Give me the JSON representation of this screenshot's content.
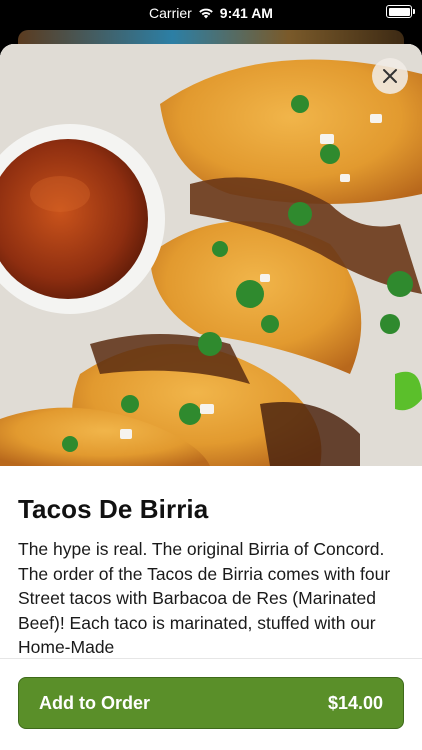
{
  "status_bar": {
    "carrier": "Carrier",
    "time": "9:41 AM",
    "battery_level": 1.0
  },
  "icons": {
    "wifi": "wifi-icon",
    "battery": "battery-icon",
    "close": "close-icon"
  },
  "item": {
    "title": "Tacos De Birria",
    "description": "The hype is real. The original Birria of Concord. The order of the Tacos de Birria comes with four Street tacos with Barbacoa de Res (Marinated Beef)! Each taco is marinated, stuffed with our Home-Made"
  },
  "order_button": {
    "label": "Add to Order",
    "price": "$14.00"
  },
  "colors": {
    "accent": "#5a8f29",
    "accent_border": "#3e6a1a",
    "text": "#111111"
  }
}
